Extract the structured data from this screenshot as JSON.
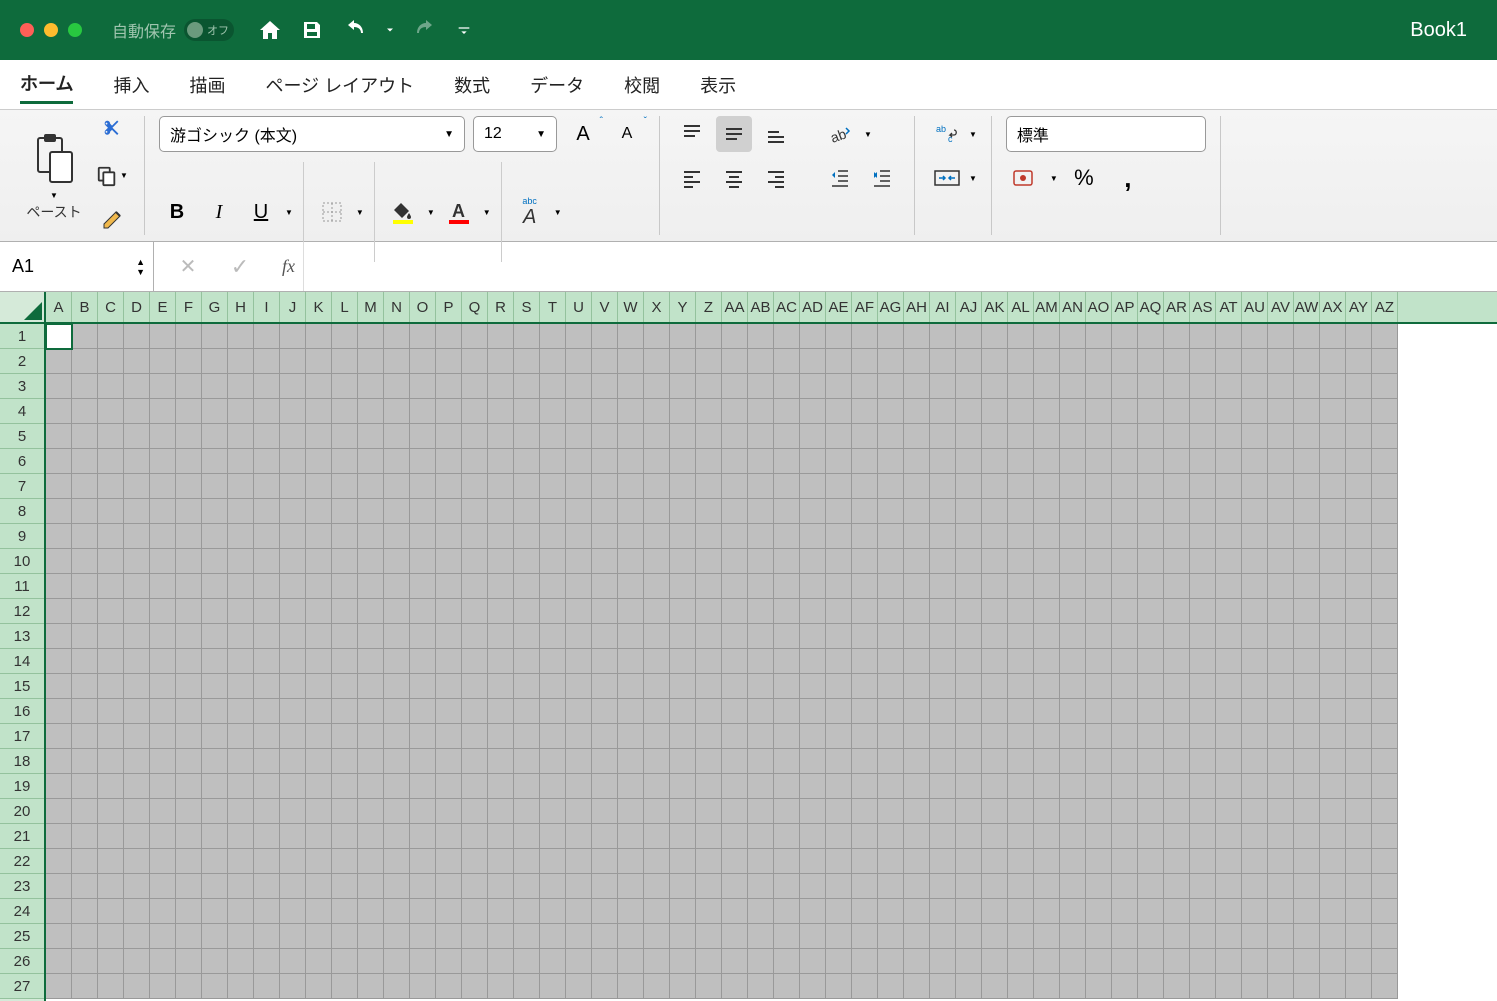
{
  "titlebar": {
    "autosave_label": "自動保存",
    "autosave_state": "オフ",
    "title": "Book1"
  },
  "tabs": [
    "ホーム",
    "挿入",
    "描画",
    "ページ レイアウト",
    "数式",
    "データ",
    "校閲",
    "表示"
  ],
  "active_tab": 0,
  "ribbon": {
    "paste_label": "ペースト",
    "font_name": "游ゴシック (本文)",
    "font_size": "12",
    "ruby_label": "abc",
    "number_format": "標準"
  },
  "formula_bar": {
    "name_box": "A1",
    "fx_label": "fx",
    "formula": ""
  },
  "columns": [
    "A",
    "B",
    "C",
    "D",
    "E",
    "F",
    "G",
    "H",
    "I",
    "J",
    "K",
    "L",
    "M",
    "N",
    "O",
    "P",
    "Q",
    "R",
    "S",
    "T",
    "U",
    "V",
    "W",
    "X",
    "Y",
    "Z",
    "AA",
    "AB",
    "AC",
    "AD",
    "AE",
    "AF",
    "AG",
    "AH",
    "AI",
    "AJ",
    "AK",
    "AL",
    "AM",
    "AN",
    "AO",
    "AP",
    "AQ",
    "AR",
    "AS",
    "AT",
    "AU",
    "AV",
    "AW",
    "AX",
    "AY",
    "AZ"
  ],
  "rows": [
    1,
    2,
    3,
    4,
    5,
    6,
    7,
    8,
    9,
    10,
    11,
    12,
    13,
    14,
    15,
    16,
    17,
    18,
    19,
    20,
    21,
    22,
    23,
    24,
    25,
    26,
    27
  ],
  "active_cell": {
    "row": 1,
    "col": "A"
  }
}
